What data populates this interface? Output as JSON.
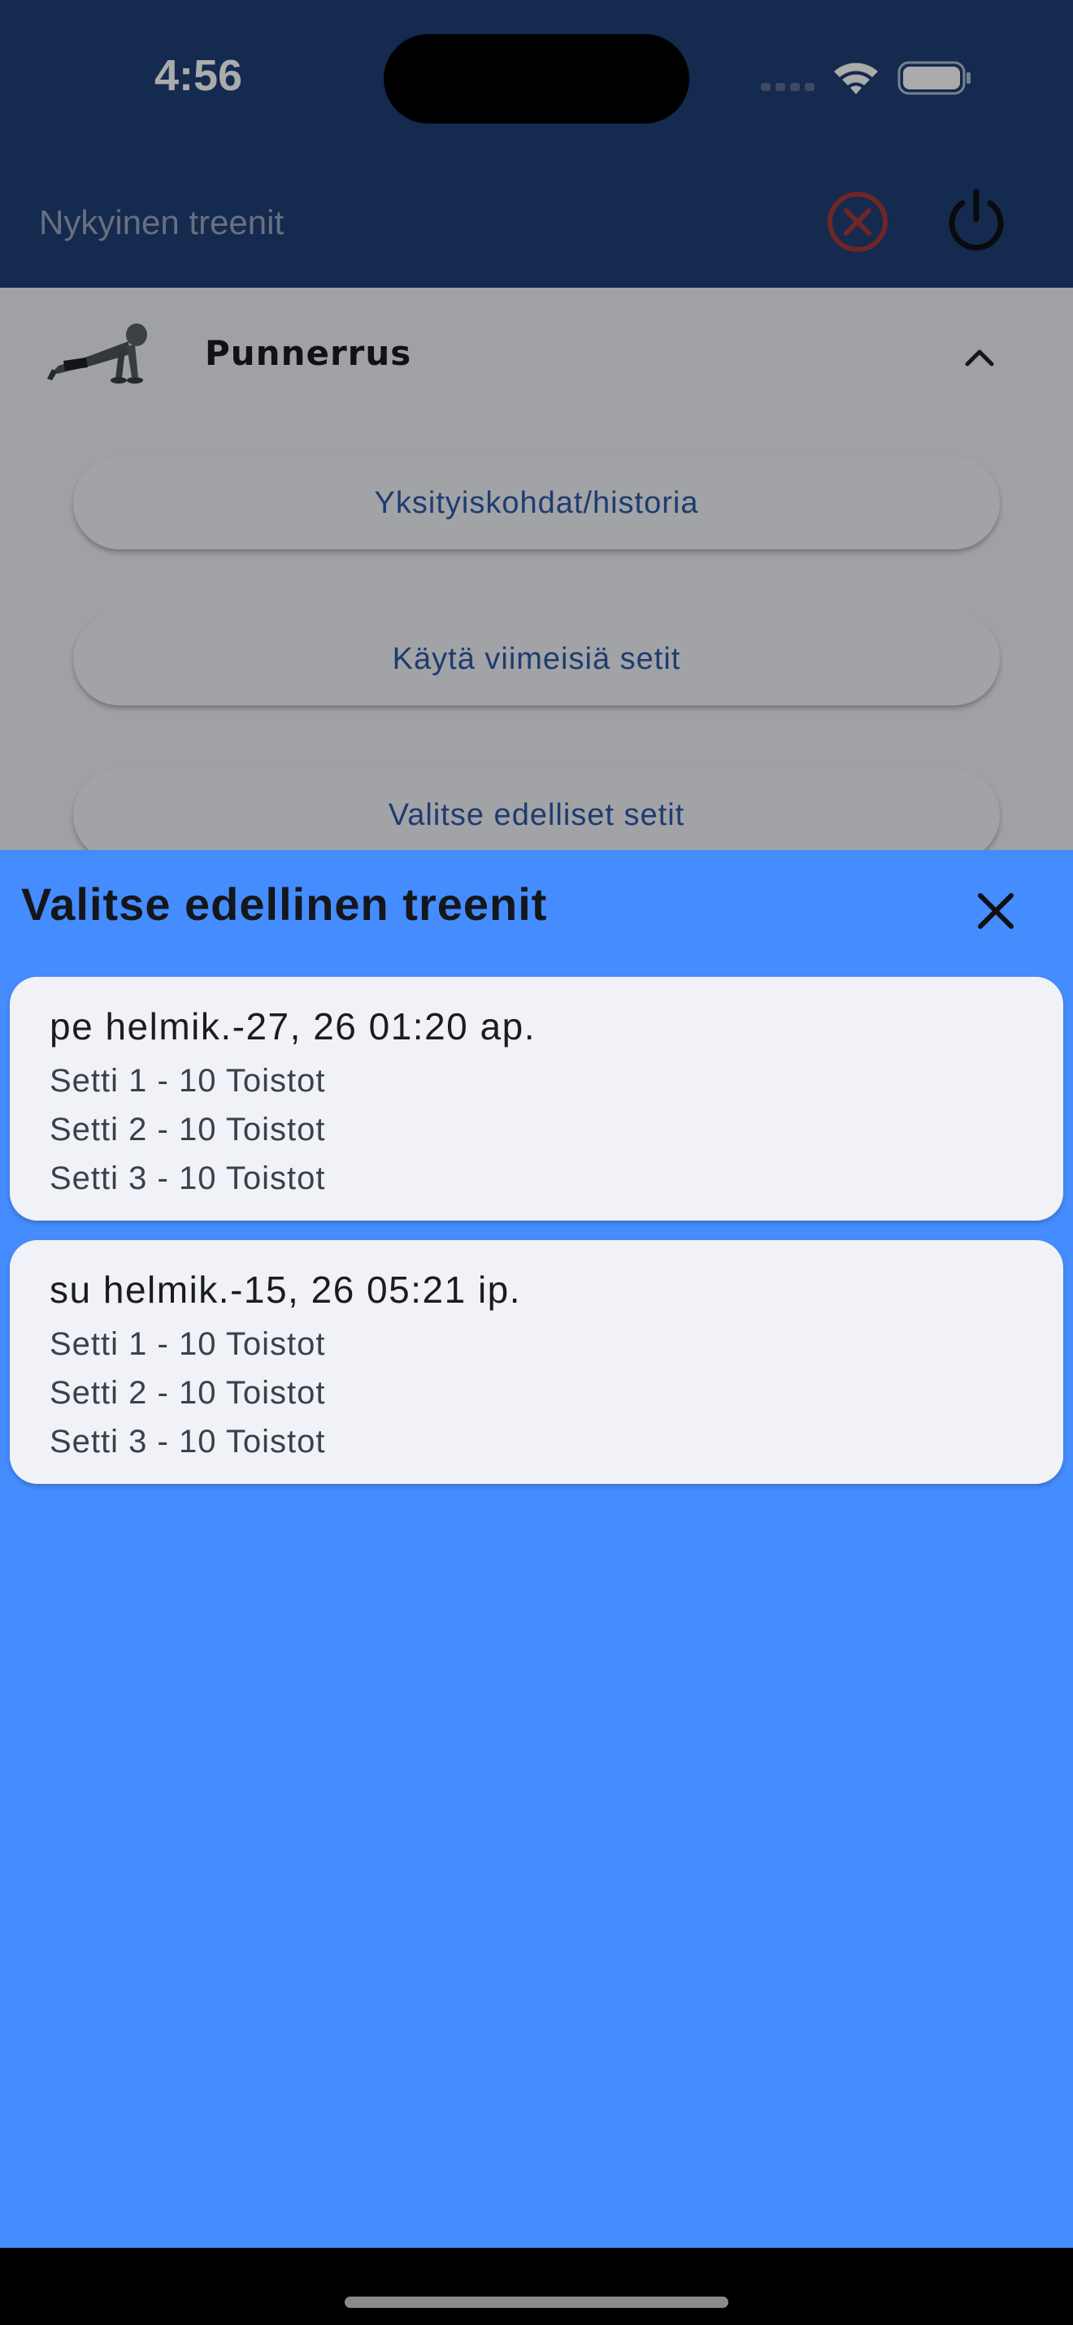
{
  "status_bar": {
    "time": "4:56"
  },
  "appbar": {
    "title": "Nykyinen treenit",
    "cancel_icon": "cancel-circle-icon",
    "power_icon": "power-icon",
    "cancel_color": "#c62828",
    "background": "#1f3f77"
  },
  "exercise": {
    "name": "Punnerrus",
    "image_icon": "pushup-figure-icon",
    "expanded_icon": "chevron-up-icon",
    "buttons": [
      {
        "label": "Yksityiskohdat/historia"
      },
      {
        "label": "Käytä viimeisiä setit"
      },
      {
        "label": "Valitse edelliset setit"
      }
    ]
  },
  "sheet": {
    "title": "Valitse edellinen treenit",
    "close_icon": "close-icon",
    "background": "#458cfe",
    "workouts": [
      {
        "date": "pe helmik.-27, 26 01:20 ap.",
        "sets": [
          "Setti 1 - 10 Toistot",
          "Setti 2 - 10 Toistot",
          "Setti 3 - 10 Toistot"
        ]
      },
      {
        "date": "su helmik.-15, 26 05:21 ip.",
        "sets": [
          "Setti 1 - 10 Toistot",
          "Setti 2 - 10 Toistot",
          "Setti 3 - 10 Toistot"
        ]
      }
    ]
  }
}
